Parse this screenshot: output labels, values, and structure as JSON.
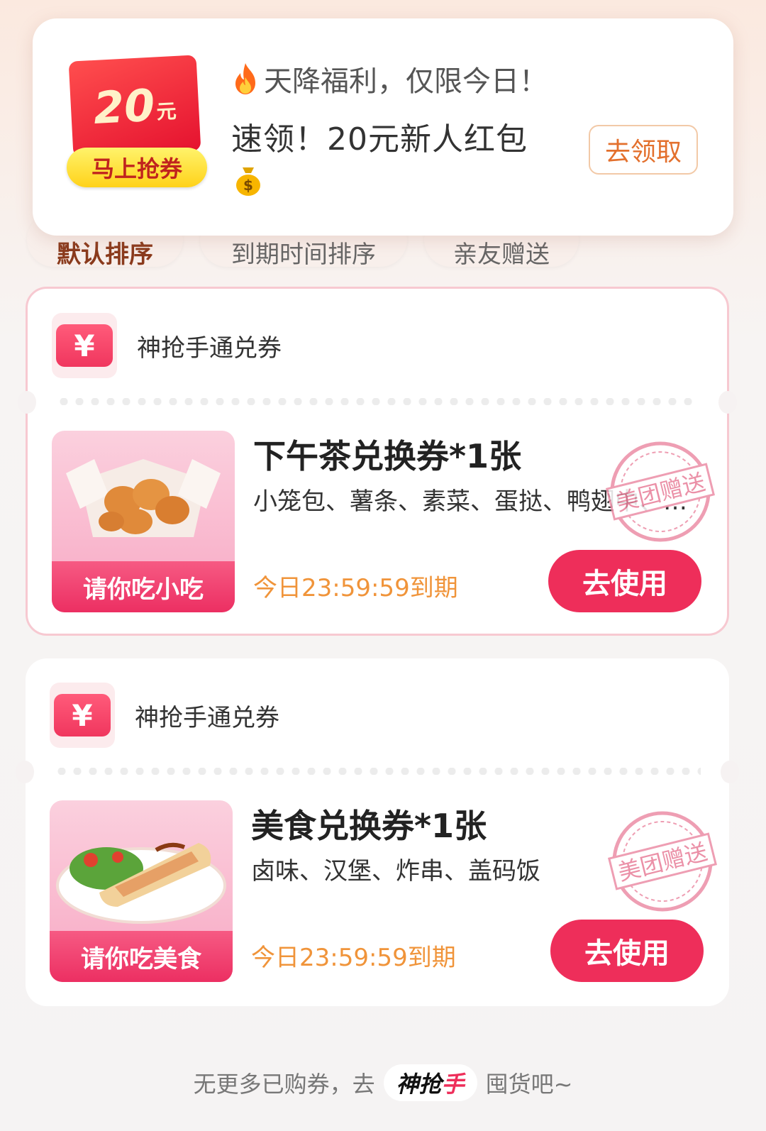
{
  "sort_tabs": [
    {
      "label": "默认排序",
      "active": true
    },
    {
      "label": "到期时间排序",
      "active": false
    },
    {
      "label": "亲友赠送",
      "active": false
    }
  ],
  "banner": {
    "ticket_amount": "20",
    "ticket_unit": "元",
    "ticket_cta": "马上抢券",
    "line1": "天降福利，仅限今日！",
    "line2": "速领！20元新人红包",
    "claim_button": "去领取"
  },
  "vouchers": [
    {
      "header": "神抢手通兑券",
      "yen": "¥",
      "thumb_label": "请你吃小吃",
      "title": "下午茶兑换券*1张",
      "desc": "小笼包、薯条、素菜、蛋挞、鸭翅中、鸡...",
      "expiry": "今日23:59:59到期",
      "button": "去使用",
      "stamp": "美团赠送"
    },
    {
      "header": "神抢手通兑券",
      "yen": "¥",
      "thumb_label": "请你吃美食",
      "title": "美食兑换券*1张",
      "desc": "卤味、汉堡、炸串、盖码饭",
      "expiry": "今日23:59:59到期",
      "button": "去使用",
      "stamp": "美团赠送"
    }
  ],
  "footer": {
    "before": "无更多已购券，去",
    "brand_a": "神抢",
    "brand_b": "手",
    "after": "囤货吧~"
  },
  "colors": {
    "primary_red": "#ee2e5a",
    "expiry_orange": "#f0943a",
    "claim_orange": "#e3702d"
  }
}
